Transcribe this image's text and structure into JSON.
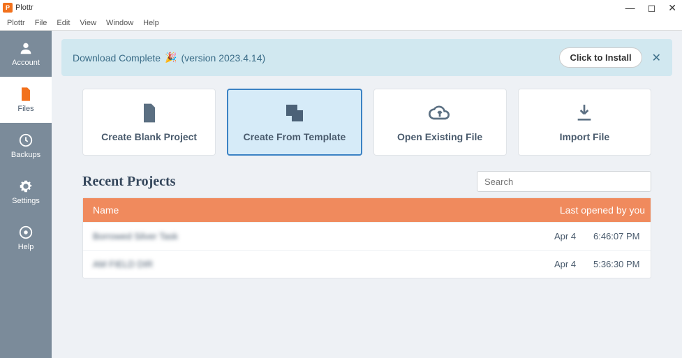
{
  "window": {
    "title": "Plottr"
  },
  "menubar": [
    "Plottr",
    "File",
    "Edit",
    "View",
    "Window",
    "Help"
  ],
  "sidebar": {
    "items": [
      {
        "label": "Account"
      },
      {
        "label": "Files"
      },
      {
        "label": "Backups"
      },
      {
        "label": "Settings"
      },
      {
        "label": "Help"
      }
    ]
  },
  "banner": {
    "text": "Download Complete",
    "version": "(version 2023.4.14)",
    "install": "Click to Install"
  },
  "cards": {
    "blank": "Create Blank Project",
    "template": "Create From Template",
    "open": "Open Existing File",
    "import": "Import File"
  },
  "recent": {
    "title": "Recent Projects",
    "search_placeholder": "Search",
    "cols": {
      "name": "Name",
      "opened": "Last opened by you"
    },
    "rows": [
      {
        "name": "Borrowed Silver Task",
        "date": "Apr 4",
        "time": "6:46:07 PM"
      },
      {
        "name": "AM FIELD DIR",
        "date": "Apr 4",
        "time": "5:36:30 PM"
      }
    ]
  }
}
